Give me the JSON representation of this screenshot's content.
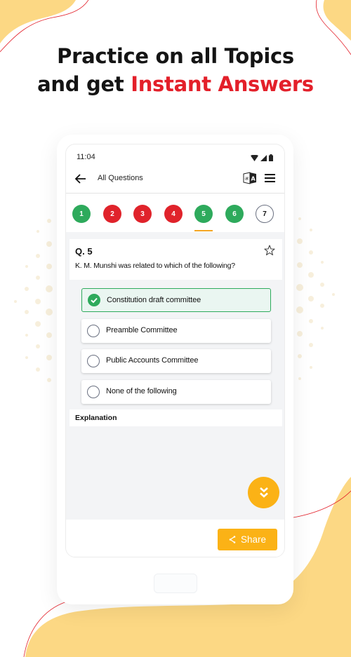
{
  "headline": {
    "line1": "Practice on all Topics",
    "line2_prefix": "and get ",
    "line2_accent": "Instant Answers"
  },
  "colors": {
    "accent_red": "#e3202a",
    "brand_yellow": "#fbb216",
    "correct_green": "#2eaa5c",
    "wrong_red": "#e0232b",
    "bg_blob_yellow": "#fcd884"
  },
  "status_bar": {
    "time": "11:04",
    "icons": [
      "wifi-icon",
      "signal-icon",
      "battery-icon"
    ]
  },
  "app_bar": {
    "back_icon": "arrow-left-icon",
    "title": "All Questions",
    "translate_icon": "translate-icon",
    "menu_icon": "hamburger-menu-icon"
  },
  "question_nav": {
    "items": [
      {
        "number": "1",
        "status": "correct"
      },
      {
        "number": "2",
        "status": "wrong"
      },
      {
        "number": "3",
        "status": "wrong"
      },
      {
        "number": "4",
        "status": "wrong"
      },
      {
        "number": "5",
        "status": "correct",
        "active": true
      },
      {
        "number": "6",
        "status": "correct"
      },
      {
        "number": "7",
        "status": "unattempted"
      }
    ]
  },
  "question": {
    "number_label": "Q. 5",
    "text": "K. M. Munshi was related to which of the following?",
    "bookmark_icon": "star-outline-icon",
    "options": [
      {
        "label": "Constitution draft committee",
        "state": "correct"
      },
      {
        "label": "Preamble Committee",
        "state": "unselected"
      },
      {
        "label": "Public Accounts Committee",
        "state": "unselected"
      },
      {
        "label": "None of the following",
        "state": "unselected"
      }
    ]
  },
  "explanation": {
    "label": "Explanation"
  },
  "fab": {
    "icon": "double-chevron-down-icon"
  },
  "bottom_bar": {
    "share_label": "Share",
    "share_icon": "share-icon"
  }
}
